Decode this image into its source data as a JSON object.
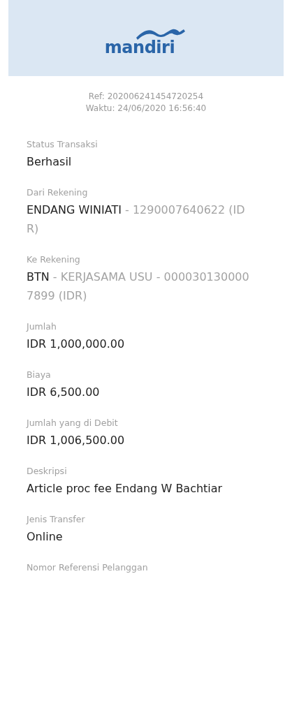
{
  "header": {
    "logo": "mandiri"
  },
  "reference": {
    "ref": "Ref: 202006241454720254",
    "time": "Waktu: 24/06/2020 16:56:40"
  },
  "fields": [
    {
      "label": "Status Transaksi",
      "value": [
        {
          "text": "Berhasil",
          "muted": false
        }
      ]
    },
    {
      "label": "Dari Rekening",
      "value": [
        {
          "text": "ENDANG WINIATI",
          "muted": false
        },
        {
          "text": " - 1290007640622 (IDR)",
          "muted": true
        }
      ]
    },
    {
      "label": "Ke Rekening",
      "value": [
        {
          "text": "BTN",
          "muted": false
        },
        {
          "text": " - KERJASAMA USU - 0000301300007899 (IDR)",
          "muted": true
        }
      ]
    },
    {
      "label": "Jumlah",
      "value": [
        {
          "text": "IDR 1,000,000.00",
          "muted": false
        }
      ]
    },
    {
      "label": "Biaya",
      "value": [
        {
          "text": "IDR 6,500.00",
          "muted": false
        }
      ]
    },
    {
      "label": "Jumlah yang di Debit",
      "value": [
        {
          "text": "IDR 1,006,500.00",
          "muted": false
        }
      ]
    },
    {
      "label": "Deskripsi",
      "value": [
        {
          "text": "Article proc fee Endang W Bachtiar",
          "muted": false
        }
      ]
    },
    {
      "label": "Jenis Transfer",
      "value": [
        {
          "text": "Online",
          "muted": false
        }
      ]
    },
    {
      "label": "Nomor Referensi Pelanggan"
    }
  ]
}
